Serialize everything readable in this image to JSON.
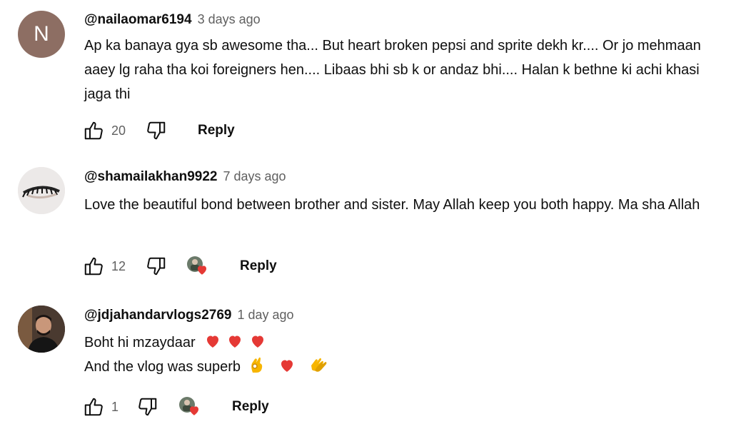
{
  "comments": [
    {
      "author": "@nailaomar6194",
      "time": "3 days ago",
      "avatar_letter": "N",
      "text": "Ap ka banaya gya sb awesome tha... But heart broken pepsi and sprite dekh kr.... Or jo mehmaan aaey lg raha tha koi foreigners hen.... Libaas bhi sb k or andaz bhi.... Halan k bethne ki achi khasi jaga thi",
      "likes": "20",
      "reply_label": "Reply"
    },
    {
      "author": "@shamailakhan9922",
      "time": "7 days ago",
      "text": "Love the beautiful bond between brother and sister. May Allah keep you both happy. Ma sha Allah",
      "likes": "12",
      "reply_label": "Reply"
    },
    {
      "author": "@jdjahandarvlogs2769",
      "time": "1 day ago",
      "text_line1": "Boht hi mzaydaar",
      "text_line2": "And the vlog was superb",
      "likes": "1",
      "reply_label": "Reply"
    }
  ],
  "colors": {
    "heart": "#e53935",
    "secondary_text": "#606060",
    "avatar_n": "#8d6e63"
  },
  "icons": [
    "thumbs-up-icon",
    "thumbs-down-icon",
    "creator-heart-icon",
    "red-heart-emoji",
    "ok-hand-emoji",
    "clapping-hands-emoji"
  ]
}
